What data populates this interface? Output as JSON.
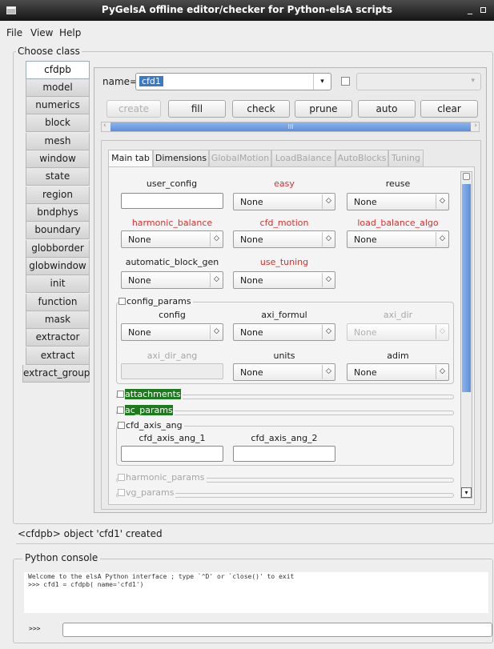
{
  "window": {
    "title": "PyGelsA offline editor/checker for Python-elsA scripts",
    "min": "_"
  },
  "menu": [
    "File",
    "View",
    "Help"
  ],
  "choose_class": {
    "label": "Choose class",
    "classes": [
      "cfdpb",
      "model",
      "numerics",
      "block",
      "mesh",
      "window",
      "state",
      "region",
      "bndphys",
      "boundary",
      "globborder",
      "globwindow",
      "init",
      "function",
      "mask",
      "extractor",
      "extract",
      "extract_group"
    ],
    "selected": "cfdpb"
  },
  "name": {
    "label": "name=",
    "value": "cfd1",
    "arrow": "▾",
    "arrow2": "▾"
  },
  "actions": {
    "create": "create",
    "fill": "fill",
    "check": "check",
    "prune": "prune",
    "auto": "auto",
    "clear": "clear"
  },
  "hscroll": {
    "left": "‹",
    "right": "›",
    "grip": "III"
  },
  "tabs": [
    "Main tab",
    "Dimensions",
    "GlobalMotion",
    "LoadBalance",
    "AutoBlocks",
    "Tuning"
  ],
  "fields": {
    "user_config": {
      "label": "user_config",
      "value": ""
    },
    "easy": {
      "label": "easy",
      "value": "None"
    },
    "reuse": {
      "label": "reuse",
      "value": "None"
    },
    "harmonic_balance": {
      "label": "harmonic_balance",
      "value": "None"
    },
    "cfd_motion": {
      "label": "cfd_motion",
      "value": "None"
    },
    "load_balance_algo": {
      "label": "load_balance_algo",
      "value": "None"
    },
    "automatic_block_gen": {
      "label": "automatic_block_gen",
      "value": "None"
    },
    "use_tuning": {
      "label": "use_tuning",
      "value": "None"
    },
    "config": {
      "label": "config",
      "value": "None"
    },
    "axi_formul": {
      "label": "axi_formul",
      "value": "None"
    },
    "axi_dir": {
      "label": "axi_dir",
      "value": "None"
    },
    "axi_dir_ang": {
      "label": "axi_dir_ang",
      "value": ""
    },
    "units": {
      "label": "units",
      "value": "None"
    },
    "adim": {
      "label": "adim",
      "value": "None"
    },
    "cfd_axis_ang_1": {
      "label": "cfd_axis_ang_1",
      "value": ""
    },
    "cfd_axis_ang_2": {
      "label": "cfd_axis_ang_2",
      "value": ""
    }
  },
  "spin": "◇",
  "groups": {
    "config_params": "config_params",
    "attachments": "attachments",
    "ac_params": "ac_params",
    "cfd_axis_ang": "cfd_axis_ang",
    "harmonic_params": "harmonic_params",
    "vg_params": "vg_params"
  },
  "vscroll": {
    "down": "▾"
  },
  "status": "<cfdpb> object 'cfd1' created",
  "console": {
    "label": "Python console",
    "output": "Welcome to the elsA Python interface ; type `^D' or `close()' to exit\n>>> cfd1 = cfdpb( name='cfd1')",
    "prompt": ">>>",
    "input": ""
  }
}
